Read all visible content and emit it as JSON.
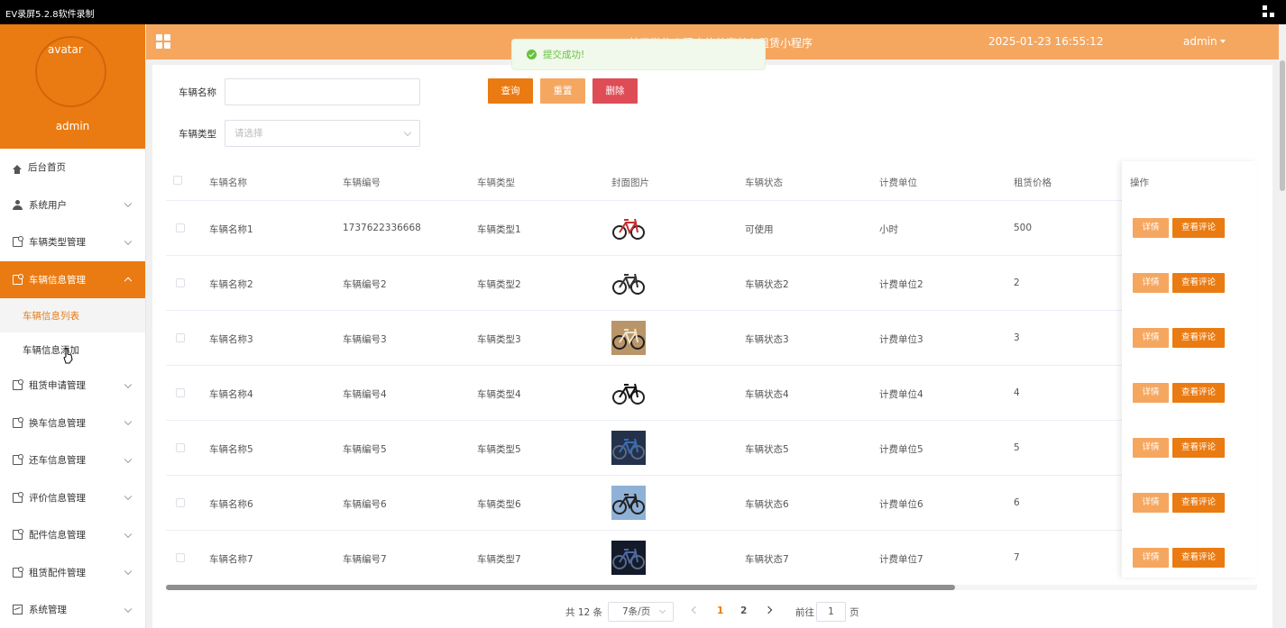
{
  "recorder": {
    "title": "EV录屏5.2.8软件录制"
  },
  "header": {
    "app_title": "基于微信小程序的共享单车租赁小程序",
    "datetime": "2025-01-23 16:55:12",
    "user": "admin"
  },
  "toast": {
    "message": "提交成功!",
    "color": "#67c23a"
  },
  "sidebar": {
    "avatar_alt": "avatar",
    "username": "admin",
    "items": [
      {
        "label": "后台首页",
        "icon": "home-icon",
        "has_children": false
      },
      {
        "label": "系统用户",
        "icon": "user-icon",
        "has_children": true
      },
      {
        "label": "车辆类型管理",
        "icon": "doc-icon",
        "has_children": true
      },
      {
        "label": "车辆信息管理",
        "icon": "doc-icon",
        "has_children": true,
        "active": true,
        "children": [
          {
            "label": "车辆信息列表",
            "active": true
          },
          {
            "label": "车辆信息添加"
          }
        ]
      },
      {
        "label": "租赁申请管理",
        "icon": "doc-icon",
        "has_children": true
      },
      {
        "label": "换车信息管理",
        "icon": "doc-icon",
        "has_children": true
      },
      {
        "label": "还车信息管理",
        "icon": "doc-icon",
        "has_children": true
      },
      {
        "label": "评价信息管理",
        "icon": "doc-icon",
        "has_children": true
      },
      {
        "label": "配件信息管理",
        "icon": "doc-icon",
        "has_children": true
      },
      {
        "label": "租赁配件管理",
        "icon": "doc-icon",
        "has_children": true
      },
      {
        "label": "系统管理",
        "icon": "chart-icon",
        "has_children": true
      }
    ]
  },
  "search": {
    "name_label": "车辆名称",
    "name_value": "",
    "type_label": "车辆类型",
    "type_placeholder": "请选择",
    "query_label": "查询",
    "reset_label": "重置",
    "delete_label": "删除"
  },
  "table": {
    "headers": [
      "车辆名称",
      "车辆编号",
      "车辆类型",
      "封面图片",
      "车辆状态",
      "计费单位",
      "租赁价格",
      "操作"
    ],
    "detail_label": "详情",
    "comment_label": "查看评论",
    "rows": [
      {
        "name": "车辆名称1",
        "code": "1737622336668",
        "type": "车辆类型1",
        "image": "bike-black-red",
        "status": "可使用",
        "unit": "小时",
        "price": "500"
      },
      {
        "name": "车辆名称2",
        "code": "车辆编号2",
        "type": "车辆类型2",
        "image": "bike-grey",
        "status": "车辆状态2",
        "unit": "计费单位2",
        "price": "2"
      },
      {
        "name": "车辆名称3",
        "code": "车辆编号3",
        "type": "车辆类型3",
        "image": "bike-shop-photo",
        "status": "车辆状态3",
        "unit": "计费单位3",
        "price": "3"
      },
      {
        "name": "车辆名称4",
        "code": "车辆编号4",
        "type": "车辆类型4",
        "image": "bike-mountain",
        "status": "车辆状态4",
        "unit": "计费单位4",
        "price": "4"
      },
      {
        "name": "车辆名称5",
        "code": "车辆编号5",
        "type": "车辆类型5",
        "image": "bike-dark-photo",
        "status": "车辆状态5",
        "unit": "计费单位5",
        "price": "5"
      },
      {
        "name": "车辆名称6",
        "code": "车辆编号6",
        "type": "车辆类型6",
        "image": "bike-blue-photo",
        "status": "车辆状态6",
        "unit": "计费单位6",
        "price": "6"
      },
      {
        "name": "车辆名称7",
        "code": "车辆编号7",
        "type": "车辆类型7",
        "image": "bike-night-photo",
        "status": "车辆状态7",
        "unit": "计费单位7",
        "price": "7"
      }
    ]
  },
  "pagination": {
    "total_text": "共 12 条",
    "page_size": "7条/页",
    "pages": [
      "1",
      "2"
    ],
    "current": "1",
    "goto_label": "前往",
    "goto_value": "1",
    "page_suffix": "页"
  },
  "colors": {
    "accent": "#ea7b12",
    "accent_light": "#f5a760",
    "danger": "#de4c56"
  }
}
